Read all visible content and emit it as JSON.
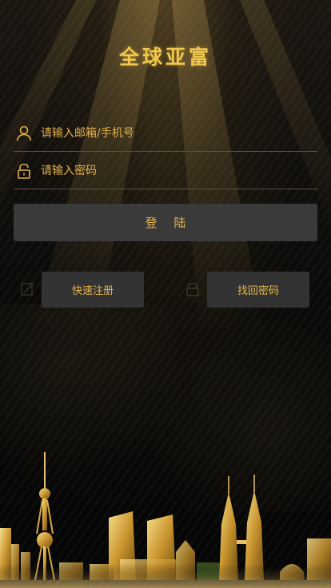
{
  "app": {
    "title": "全球亚富"
  },
  "login_form": {
    "account_placeholder": "请输入邮箱/手机号",
    "account_value": "",
    "password_placeholder": "请输入密码",
    "password_value": "",
    "login_label": "登 陆"
  },
  "actions": {
    "register_label": "快速注册",
    "recover_label": "找回密码"
  },
  "colors": {
    "accent_gold": "#e7b54a",
    "button_bg": "#3a3a3a",
    "background": "#050505"
  },
  "icons": {
    "account": "user-icon",
    "password": "lock-icon",
    "register": "edit-icon",
    "recover": "lock-icon"
  }
}
